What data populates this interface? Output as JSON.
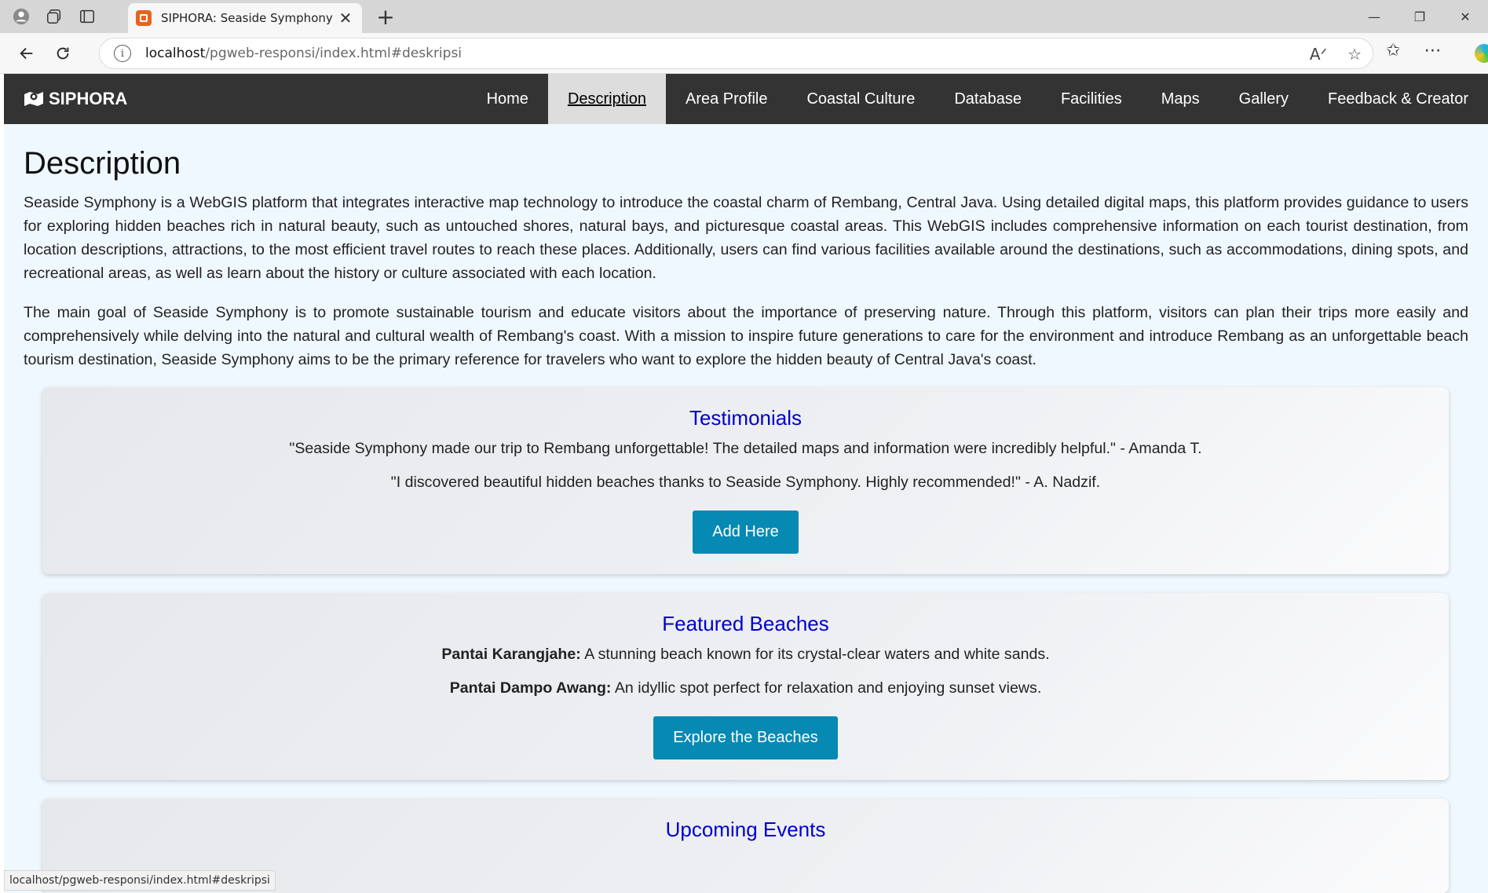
{
  "browser": {
    "tab_title": "SIPHORA: Seaside Symphony Rem",
    "tab_close": "✕",
    "new_tab": "+",
    "url_host": "localhost",
    "url_path": "/pgweb-responsi/index.html#deskripsi",
    "status_url": "localhost/pgweb-responsi/index.html#deskripsi"
  },
  "site": {
    "brand": "SIPHORA",
    "nav": [
      {
        "label": "Home"
      },
      {
        "label": "Description"
      },
      {
        "label": "Area Profile"
      },
      {
        "label": "Coastal Culture"
      },
      {
        "label": "Database"
      },
      {
        "label": "Facilities"
      },
      {
        "label": "Maps"
      },
      {
        "label": "Gallery"
      },
      {
        "label": "Feedback & Creator"
      }
    ],
    "active_nav": "Description"
  },
  "main": {
    "title": "Description",
    "paragraphs": [
      "Seaside Symphony is a WebGIS platform that integrates interactive map technology to introduce the coastal charm of Rembang, Central Java. Using detailed digital maps, this platform provides guidance to users for exploring hidden beaches rich in natural beauty, such as untouched shores, natural bays, and picturesque coastal areas. This WebGIS includes comprehensive information on each tourist destination, from location descriptions, attractions, to the most efficient travel routes to reach these places. Additionally, users can find various facilities available around the destinations, such as accommodations, dining spots, and recreational areas, as well as learn about the history or culture associated with each location.",
      "The main goal of Seaside Symphony is to promote sustainable tourism and educate visitors about the importance of preserving nature. Through this platform, visitors can plan their trips more easily and comprehensively while delving into the natural and cultural wealth of Rembang's coast. With a mission to inspire future generations to care for the environment and introduce Rembang as an unforgettable beach tourism destination, Seaside Symphony aims to be the primary reference for travelers who want to explore the hidden beauty of Central Java's coast."
    ]
  },
  "testimonials": {
    "title": "Testimonials",
    "quotes": [
      "\"Seaside Symphony made our trip to Rembang unforgettable! The detailed maps and information were incredibly helpful.\" - Amanda T.",
      "\"I discovered beautiful hidden beaches thanks to Seaside Symphony. Highly recommended!\" - A. Nadzif."
    ],
    "button": "Add Here"
  },
  "featured": {
    "title": "Featured Beaches",
    "items": [
      {
        "name": "Pantai Karangjahe:",
        "text": " A stunning beach known for its crystal-clear waters and white sands."
      },
      {
        "name": "Pantai Dampo Awang:",
        "text": " An idyllic spot perfect for relaxation and enjoying sunset views."
      }
    ],
    "button": "Explore the Beaches"
  },
  "events": {
    "title": "Upcoming Events"
  },
  "colors": {
    "nav_bg": "#333333",
    "page_bg": "#f0f8ff",
    "heading_blue": "#0000cc",
    "button": "#0689b3"
  }
}
